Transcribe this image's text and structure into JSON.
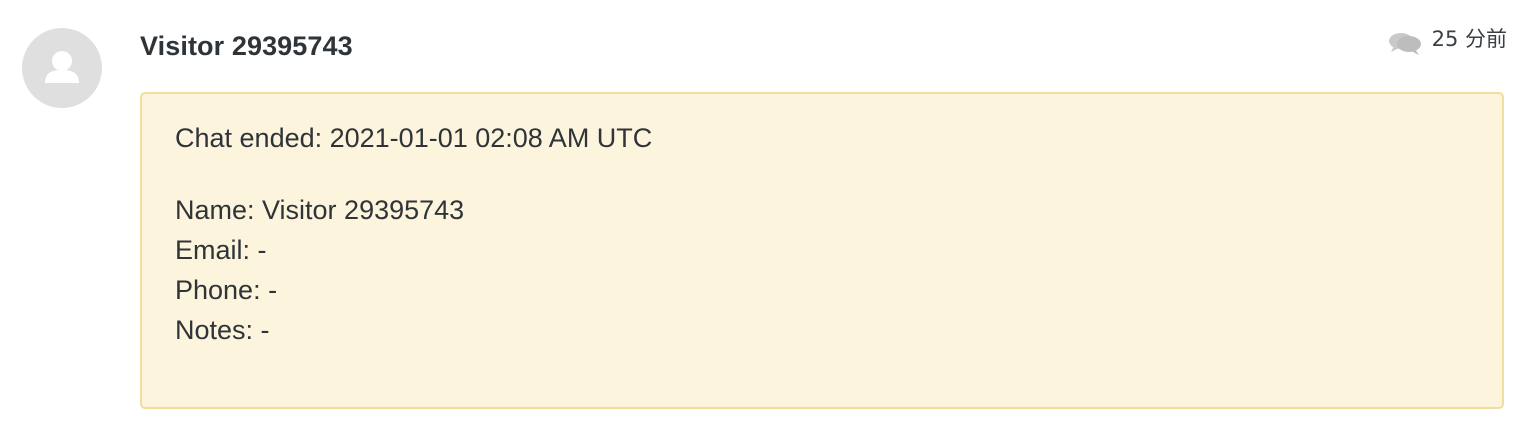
{
  "message": {
    "author": "Visitor 29395743",
    "time": "25 分前",
    "avatar_icon": "user-silhouette-icon",
    "chat_icon": "chat-bubbles-icon"
  },
  "note": {
    "chat_ended": "Chat ended: 2021-01-01 02:08 AM UTC",
    "name": "Name: Visitor 29395743",
    "email": "Email: -",
    "phone": "Phone: -",
    "notes": "Notes: -"
  },
  "colors": {
    "note_background": "#fcf4dc",
    "note_border": "#f2dd9f",
    "avatar_background": "#dfdfdf",
    "text": "#2f3438"
  }
}
